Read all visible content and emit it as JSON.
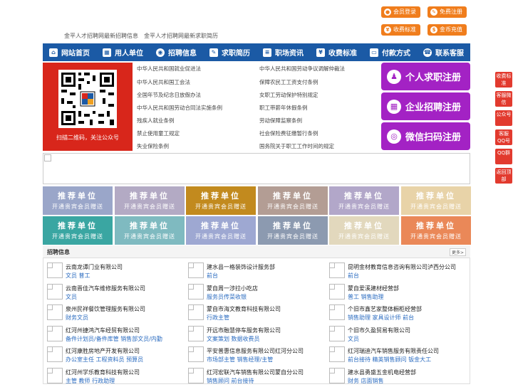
{
  "top_buttons": [
    {
      "label": "会员登录",
      "icon": "user-icon",
      "glyph": "●"
    },
    {
      "label": "免费注册",
      "icon": "register-icon",
      "glyph": "✎"
    },
    {
      "label": "收费标准",
      "icon": "money-icon",
      "glyph": "¥"
    },
    {
      "label": "金币充值",
      "icon": "coin-icon",
      "glyph": "$"
    }
  ],
  "top_links": [
    "金平人才招聘网最新招聘信息",
    "金平人才招聘网最新求职简历"
  ],
  "nav": [
    {
      "label": "网站首页",
      "icon": "home-icon",
      "glyph": "⌂"
    },
    {
      "label": "用人单位",
      "icon": "building-icon",
      "glyph": "▦"
    },
    {
      "label": "招聘信息",
      "icon": "megaphone-icon",
      "glyph": "◉"
    },
    {
      "label": "求职简历",
      "icon": "resume-icon",
      "glyph": "✎"
    },
    {
      "label": "职场资讯",
      "icon": "news-icon",
      "glyph": "≡"
    },
    {
      "label": "收费标准",
      "icon": "money-icon",
      "glyph": "¥"
    },
    {
      "label": "付款方式",
      "icon": "card-icon",
      "glyph": "▭"
    },
    {
      "label": "联系客服",
      "icon": "headset-icon",
      "glyph": "☎"
    }
  ],
  "qr_caption": "扫描二维码，关注公众号",
  "laws_left": [
    "中华人民共和国就业促进法",
    "中华人民共和国工会法",
    "全国年节及纪念日放假办法",
    "中华人民共和国劳动合同法实施条例",
    "残疾人就业条例",
    "禁止使用童工规定",
    "失业保险条例"
  ],
  "laws_right": [
    "中华人民共和国劳动争议调解仲裁法",
    "保障农民工工资支付条例",
    "女职工劳动保护特别规定",
    "职工带薪年休假条例",
    "劳动保障监察条例",
    "社会保险费征缴暂行条例",
    "国务院关于职工工作时间的规定"
  ],
  "reg_buttons": [
    {
      "label": "个人求职注册",
      "icon": "person-icon",
      "glyph": "♟"
    },
    {
      "label": "企业招聘注册",
      "icon": "company-icon",
      "glyph": "▦"
    },
    {
      "label": "微信扫码注册",
      "icon": "wechat-icon",
      "glyph": "◎"
    }
  ],
  "side_bar": [
    {
      "label": "收费标准",
      "icon": "money-icon"
    },
    {
      "label": "客服微信",
      "icon": "wechat-icon"
    },
    {
      "label": "公众号",
      "icon": "qr-icon"
    },
    {
      "label": "客服QQ号",
      "icon": "qq-icon"
    },
    {
      "label": "QQ群",
      "icon": "group-icon"
    },
    {
      "label": "返回顶部",
      "icon": "arrow-up-icon"
    }
  ],
  "recommend": {
    "title": "推荐单位",
    "subtitle": "开通贵宾会员赠送",
    "colors": [
      "#9aa6c9",
      "#b3aac4",
      "#c28a1e",
      "#b39d94",
      "#b2a7c9",
      "#e8d3a8",
      "#3aa6a2",
      "#7fbac0",
      "#9ea8d2",
      "#8c9ab0",
      "#e2d8bd",
      "#ea8858"
    ]
  },
  "jobs_section": {
    "title": "招聘信息",
    "more": "更多>",
    "items": [
      {
        "company": "云南龙谭门业有限公司",
        "positions": "文员 普工"
      },
      {
        "company": "建水县一格装饰设计服务部",
        "positions": "前台"
      },
      {
        "company": "昆明金材教育信息咨询有限公司泸西分公司",
        "positions": "前台"
      },
      {
        "company": "云南晋佳汽车维修服务有限公司",
        "positions": "文员"
      },
      {
        "company": "蒙自周一涉拉小吃店",
        "positions": "服务员传菜收银"
      },
      {
        "company": "蒙自爱溪建材经营部",
        "positions": "普工 销售助理"
      },
      {
        "company": "泉州民祥餐饮管理服务有限公司",
        "positions": "财务文员"
      },
      {
        "company": "蒙自市海文教育科技有限公司",
        "positions": "行政主管"
      },
      {
        "company": "个旧市鑫艺家整体橱柜经营部",
        "positions": "销售助理 家具设计师 前台"
      },
      {
        "company": "红河州捷鸿汽车经贸有限公司",
        "positions": "备件计划员/备件库管 销售部文员/内勤"
      },
      {
        "company": "开远市融慧停车服务有限公司",
        "positions": "文案策划 数据收费员"
      },
      {
        "company": "个旧市久盈贸易有限公司",
        "positions": "文员"
      },
      {
        "company": "红河康胜房地产开发有限公司",
        "positions": "办公室主任 工程资料员 预算员"
      },
      {
        "company": "平安普惠信息服务有限公司红河分公司",
        "positions": "市场部主管 销售经理/主管"
      },
      {
        "company": "红河瑞迪汽车销售服务有限责任公司",
        "positions": "前台接待 精英销售顾问 钣金大工"
      },
      {
        "company": "红河州学乐教育科技有限公司",
        "positions": "主管 教师 行政助理"
      },
      {
        "company": "红河宏联汽车销售有限公司蒙自分公司",
        "positions": "销售顾问 前台接待"
      },
      {
        "company": "建水县勇盛五金机电经营部",
        "positions": "财务 店面销售"
      }
    ]
  }
}
